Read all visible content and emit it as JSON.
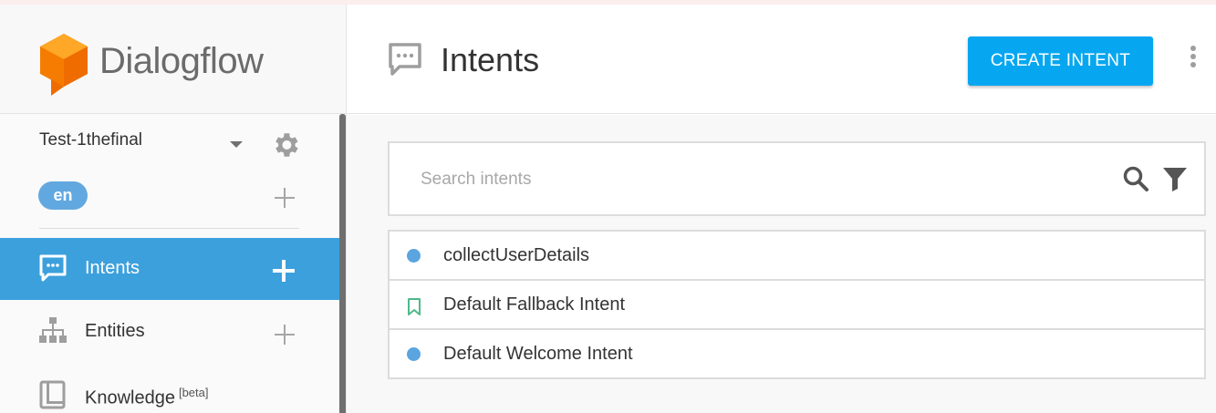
{
  "app": {
    "name": "Dialogflow",
    "brand_color": "#f57c00"
  },
  "sidebar": {
    "agent_name": "Test-1thefinal",
    "language": "en",
    "nav": [
      {
        "label": "Intents",
        "icon": "chat-bubble-icon",
        "active": true
      },
      {
        "label": "Entities",
        "icon": "hierarchy-icon",
        "active": false
      },
      {
        "label": "Knowledge",
        "icon": "book-icon",
        "active": false,
        "badge": "[beta]"
      }
    ],
    "active_color": "#3ca0dd"
  },
  "header": {
    "title": "Intents",
    "icon": "chat-bubble-icon",
    "create_button": "CREATE INTENT",
    "accent_color": "#06a7f0"
  },
  "search": {
    "placeholder": "Search intents"
  },
  "intents": [
    {
      "name": "collectUserDetails",
      "marker": "dot"
    },
    {
      "name": "Default Fallback Intent",
      "marker": "bookmark"
    },
    {
      "name": "Default Welcome Intent",
      "marker": "dot"
    }
  ]
}
